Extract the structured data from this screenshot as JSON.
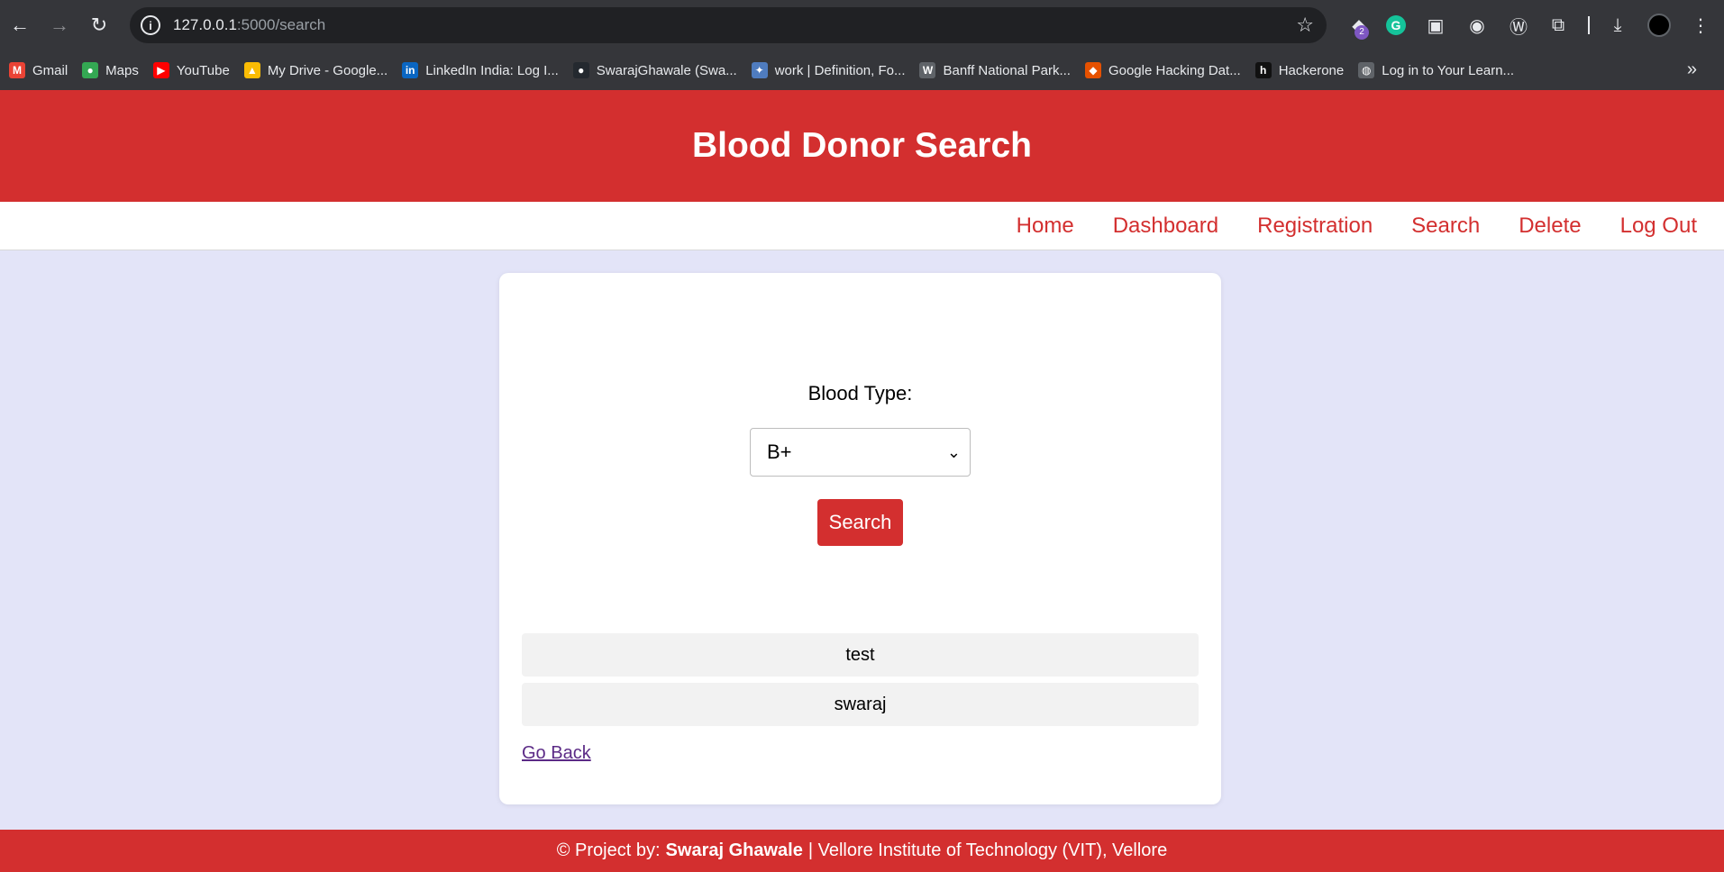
{
  "browser": {
    "url_host": "127.0.0.1",
    "url_path": ":5000/search",
    "extension_badge": "2",
    "bookmarks": [
      {
        "label": "Gmail",
        "icon": "gmail-icon",
        "color": "#ea4335",
        "glyph": "M"
      },
      {
        "label": "Maps",
        "icon": "maps-icon",
        "color": "#34a853",
        "glyph": "●"
      },
      {
        "label": "YouTube",
        "icon": "youtube-icon",
        "color": "#ff0000",
        "glyph": "▶"
      },
      {
        "label": "My Drive - Google...",
        "icon": "drive-icon",
        "color": "#fbbc04",
        "glyph": "▲"
      },
      {
        "label": "LinkedIn India: Log I...",
        "icon": "linkedin-icon",
        "color": "#0a66c2",
        "glyph": "in"
      },
      {
        "label": "SwarajGhawale (Swa...",
        "icon": "github-icon",
        "color": "#24292f",
        "glyph": "●"
      },
      {
        "label": "work | Definition, Fo...",
        "icon": "dictionary-icon",
        "color": "#4f7cbf",
        "glyph": "✦"
      },
      {
        "label": "Banff National Park...",
        "icon": "banff-icon",
        "color": "#5f6368",
        "glyph": "W"
      },
      {
        "label": "Google Hacking Dat...",
        "icon": "exploit-db-icon",
        "color": "#e65100",
        "glyph": "◆"
      },
      {
        "label": "Hackerone",
        "icon": "hackerone-icon",
        "color": "#111111",
        "glyph": "h"
      },
      {
        "label": "Log in to Your Learn...",
        "icon": "globe-icon",
        "color": "#5f6368",
        "glyph": "◍"
      }
    ]
  },
  "page": {
    "title": "Blood Donor Search",
    "nav": [
      "Home",
      "Dashboard",
      "Registration",
      "Search",
      "Delete",
      "Log Out"
    ],
    "form": {
      "label": "Blood Type:",
      "selected_blood_type": "B+",
      "search_button": "Search"
    },
    "results": [
      "test",
      "swaraj"
    ],
    "go_back": "Go Back",
    "footer": {
      "prefix": "© Project by:",
      "author": "Swaraj Ghawale",
      "suffix": "| Vellore Institute of Technology (VIT), Vellore"
    }
  },
  "colors": {
    "brand_red": "#d32f2f",
    "page_bg": "#e3e4f8"
  }
}
